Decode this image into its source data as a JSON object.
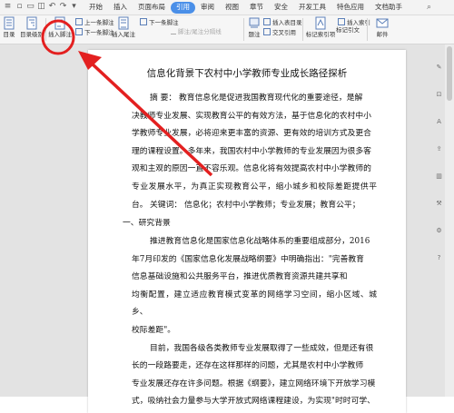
{
  "menu": {
    "tabs": [
      "开始",
      "插入",
      "页面布局",
      "引用",
      "审阅",
      "视图",
      "章节",
      "安全",
      "开发工具",
      "特色应用",
      "文档助手"
    ],
    "active_tab": "引用"
  },
  "ribbon": {
    "toc_label": "目录",
    "toc_level_label": "目录级别",
    "insert_footnote_label": "插入脚注",
    "prev_footnote_label": "上一条脚注",
    "next_footnote_label": "下一条脚注",
    "insert_endnote_label": "插入尾注",
    "footnote_endnote_sep_label": "脚注/尾注分隔线",
    "caption_label": "题注",
    "cross_ref_label": "交叉引用",
    "insert_index_label": "插入索引",
    "mark_index_label": "标记索引项",
    "mark_citation_label": "标记引文",
    "mail_label": "邮件",
    "insert_toc_label": "插入表目录"
  },
  "document": {
    "title": "信息化背景下农村中小学教师专业成长路径探析",
    "abstract_lines": [
      "摘    要：  教育信息化是促进我国教育现代化的重要途径，是解",
      "决教师专业发展、实现教育公平的有效方法，基于信息化的农村中小",
      "学教师专业发展，必将迎来更丰富的资源、更有效的培训方式及更合",
      "理的课程设置。多年来，我国农村中小学教师的专业发展因为很多客",
      "观和主观的原因一直不容乐观。信息化将有效提高农村中小学教师的",
      "专业发展水平，为真正实现教育公平，缩小城乡和校际差距提供平台。"
    ],
    "keywords": "关键词：    信息化；农村中小学教师；专业发展；教育公平；",
    "section1": "一、研究背景",
    "body_lines": [
      "推进教育信息化是国家信息化战略体系的重要组成部分，2016",
      "年7月印发的《国家信息化发展战略纲要》中明确指出：\"完善教育",
      "信息基础设施和公共服务平台，推进优质教育资源共建共享和",
      "均衡配置，建立适应教育模式变革的网络学习空间，缩小区域、城乡、",
      "校际差距\"。",
      "目前，我国各级各类教师专业发展取得了一些成效，但是还有很",
      "长的一段路要走，还存在这样那样的问题，尤其是农村中小学教师",
      "专业发展还存在许多问题。根据《纲要》，建立网络环境下开放学习模",
      "式，吸纳社会力量参与大学开放式网络课程建设，为实现\"时时可学、"
    ]
  },
  "colors": {
    "annotation": "#e32020",
    "active_tab": "#4a8fe8"
  }
}
